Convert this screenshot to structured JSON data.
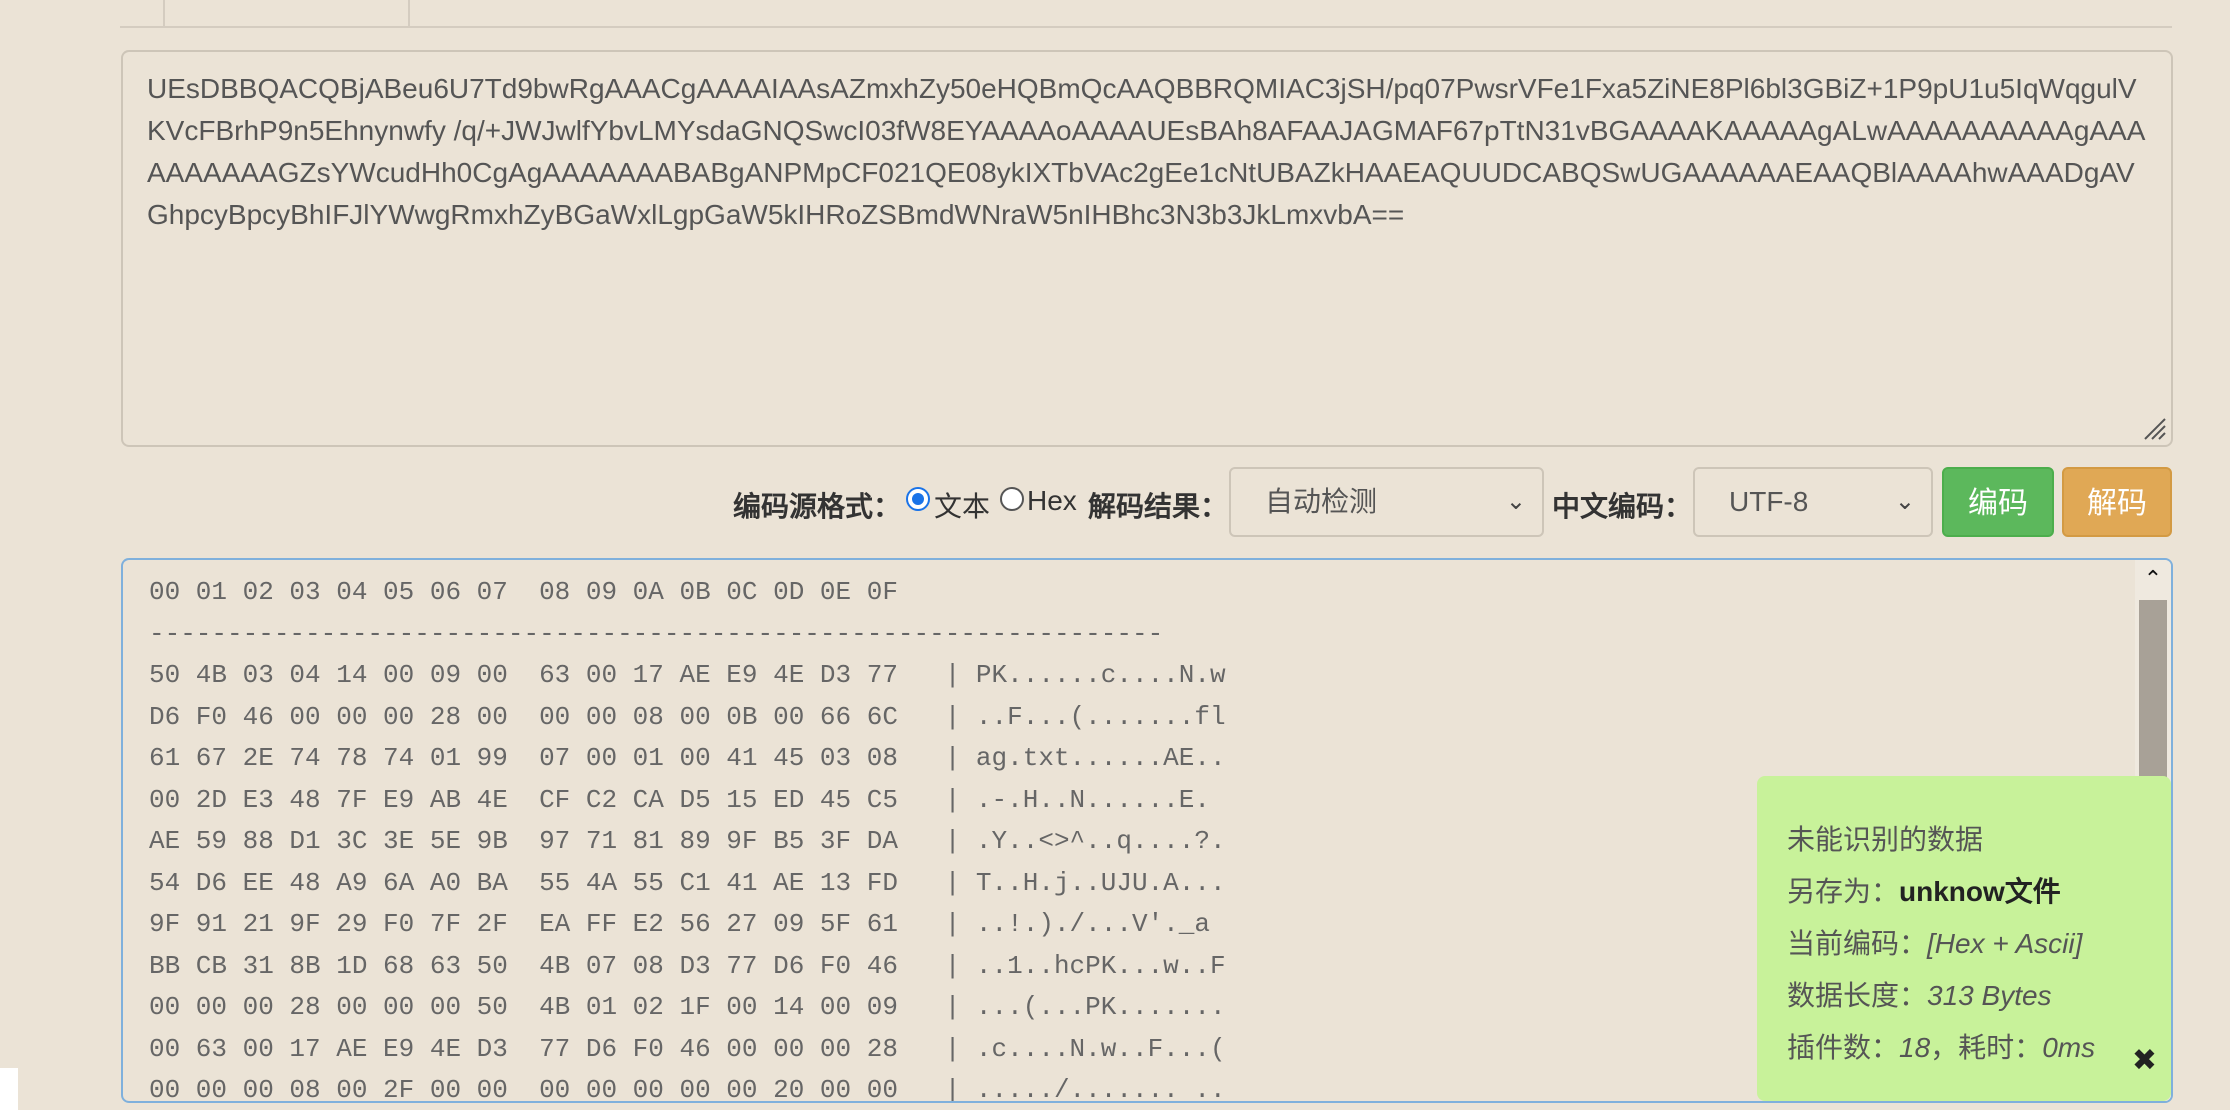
{
  "input": {
    "base64_text": "UEsDBBQACQBjABeu6U7Td9bwRgAAACgAAAAIAAsAZmxhZy50eHQBmQcAAQBBRQMIAC3jSH/pq07PwsrVFe1Fxa5ZiNE8Pl6bl3GBiZ+1P9pU1u5IqWqgulVKVcFBrhP9n5Ehnynwfy /q/+JWJwlfYbvLMYsdaGNQSwcI03fW8EYAAAAoAAAAUEsBAh8AFAAJAGMAF67pTtN31vBGAAAAKAAAAAgALwAAAAAAAAAAgAAAAAAAAAAGZsYWcudHh0CgAgAAAAAAABABgANPMpCF021QE08ykIXTbVAc2gEe1cNtUBAZkHAAEAQUUDCABQSwUGAAAAAAEAAQBlAAAAhwAAADgAVGhpcyBpcyBhIFJlYWwgRmxhZyBGaWxlLgpGaW5kIHRoZSBmdWNraW5nIHBhc3N3b3JkLmxvbA=="
  },
  "controls": {
    "source_format_label": "编码源格式：",
    "radio_text_label": "文本",
    "radio_hex_label": "Hex",
    "decode_result_label": "解码结果：",
    "decode_result_selected": "自动检测",
    "chinese_encoding_label": "中文编码：",
    "chinese_encoding_selected": "UTF-8",
    "encode_button": "编码",
    "decode_button": "解码"
  },
  "output": {
    "hex_dump": "00 01 02 03 04 05 06 07  08 09 0A 0B 0C 0D 0E 0F\n-----------------------------------------------------------------\n50 4B 03 04 14 00 09 00  63 00 17 AE E9 4E D3 77   | PK......c....N.w\nD6 F0 46 00 00 00 28 00  00 00 08 00 0B 00 66 6C   | ..F...(.......fl\n61 67 2E 74 78 74 01 99  07 00 01 00 41 45 03 08   | ag.txt......AE..\n00 2D E3 48 7F E9 AB 4E  CF C2 CA D5 15 ED 45 C5   | .-.H..N......E.\nAE 59 88 D1 3C 3E 5E 9B  97 71 81 89 9F B5 3F DA   | .Y..<>^..q....?.\n54 D6 EE 48 A9 6A A0 BA  55 4A 55 C1 41 AE 13 FD   | T..H.j..UJU.A...\n9F 91 21 9F 29 F0 7F 2F  EA FF E2 56 27 09 5F 61   | ..!.)./...V'._a\nBB CB 31 8B 1D 68 63 50  4B 07 08 D3 77 D6 F0 46   | ..1..hcPK...w..F\n00 00 00 28 00 00 00 50  4B 01 02 1F 00 14 00 09   | ...(...PK.......\n00 63 00 17 AE E9 4E D3  77 D6 F0 46 00 00 00 28   | .c....N.w..F...(\n00 00 00 08 00 2F 00 00  00 00 00 00 00 20 00 00   | ...../....... .."
  },
  "info_panel": {
    "line1": "未能识别的数据",
    "save_as_label": "另存为：",
    "save_as_value": "unknow文件",
    "encoding_label": "当前编码：",
    "encoding_value": "[Hex + Ascii]",
    "length_label": "数据长度：",
    "length_value": "313 Bytes",
    "plugins_label": "插件数：",
    "plugins_value": "18",
    "time_label": "，耗时：",
    "time_value": "0ms"
  },
  "icons": {
    "close": "close-icon",
    "scroll_up": "chevron-up-icon",
    "select_arrow": "chevron-down-icon",
    "resize": "resize-grip-icon"
  },
  "colors": {
    "background": "#ebe3d6",
    "encode_button": "#5cb85c",
    "decode_button": "#e0a855",
    "info_panel": "#c8f29a",
    "radio_checked": "#1a73e8"
  }
}
